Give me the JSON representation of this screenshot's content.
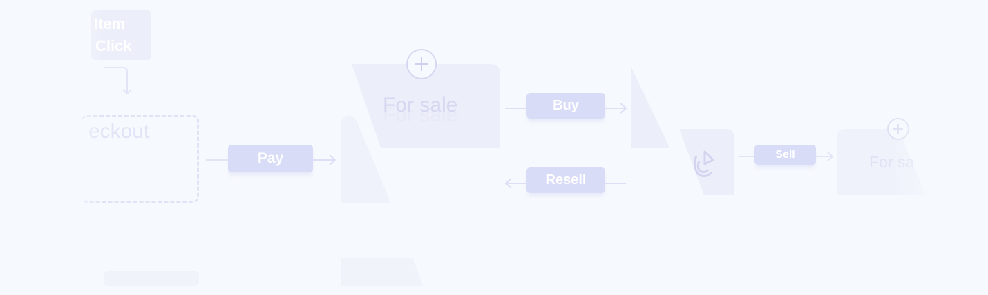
{
  "top_card": {
    "line1": "Item",
    "line2": "Click"
  },
  "checkout": {
    "label": "eckout"
  },
  "pay_button": {
    "label": "Pay"
  },
  "for_sale_main": {
    "label": "For sale",
    "ghost": "For sale"
  },
  "buy_button": {
    "label": "Buy"
  },
  "resell_button": {
    "label": "Resell"
  },
  "sell_button": {
    "label": "Sell"
  },
  "for_sale_right": {
    "label": "For sa"
  },
  "colors": {
    "accent": "#d9dcf7",
    "line": "#d7d9f5",
    "background": "#f6f9fd"
  },
  "icons": [
    "plus-circle-icon",
    "pizza-icon",
    "plus-circle-icon"
  ]
}
